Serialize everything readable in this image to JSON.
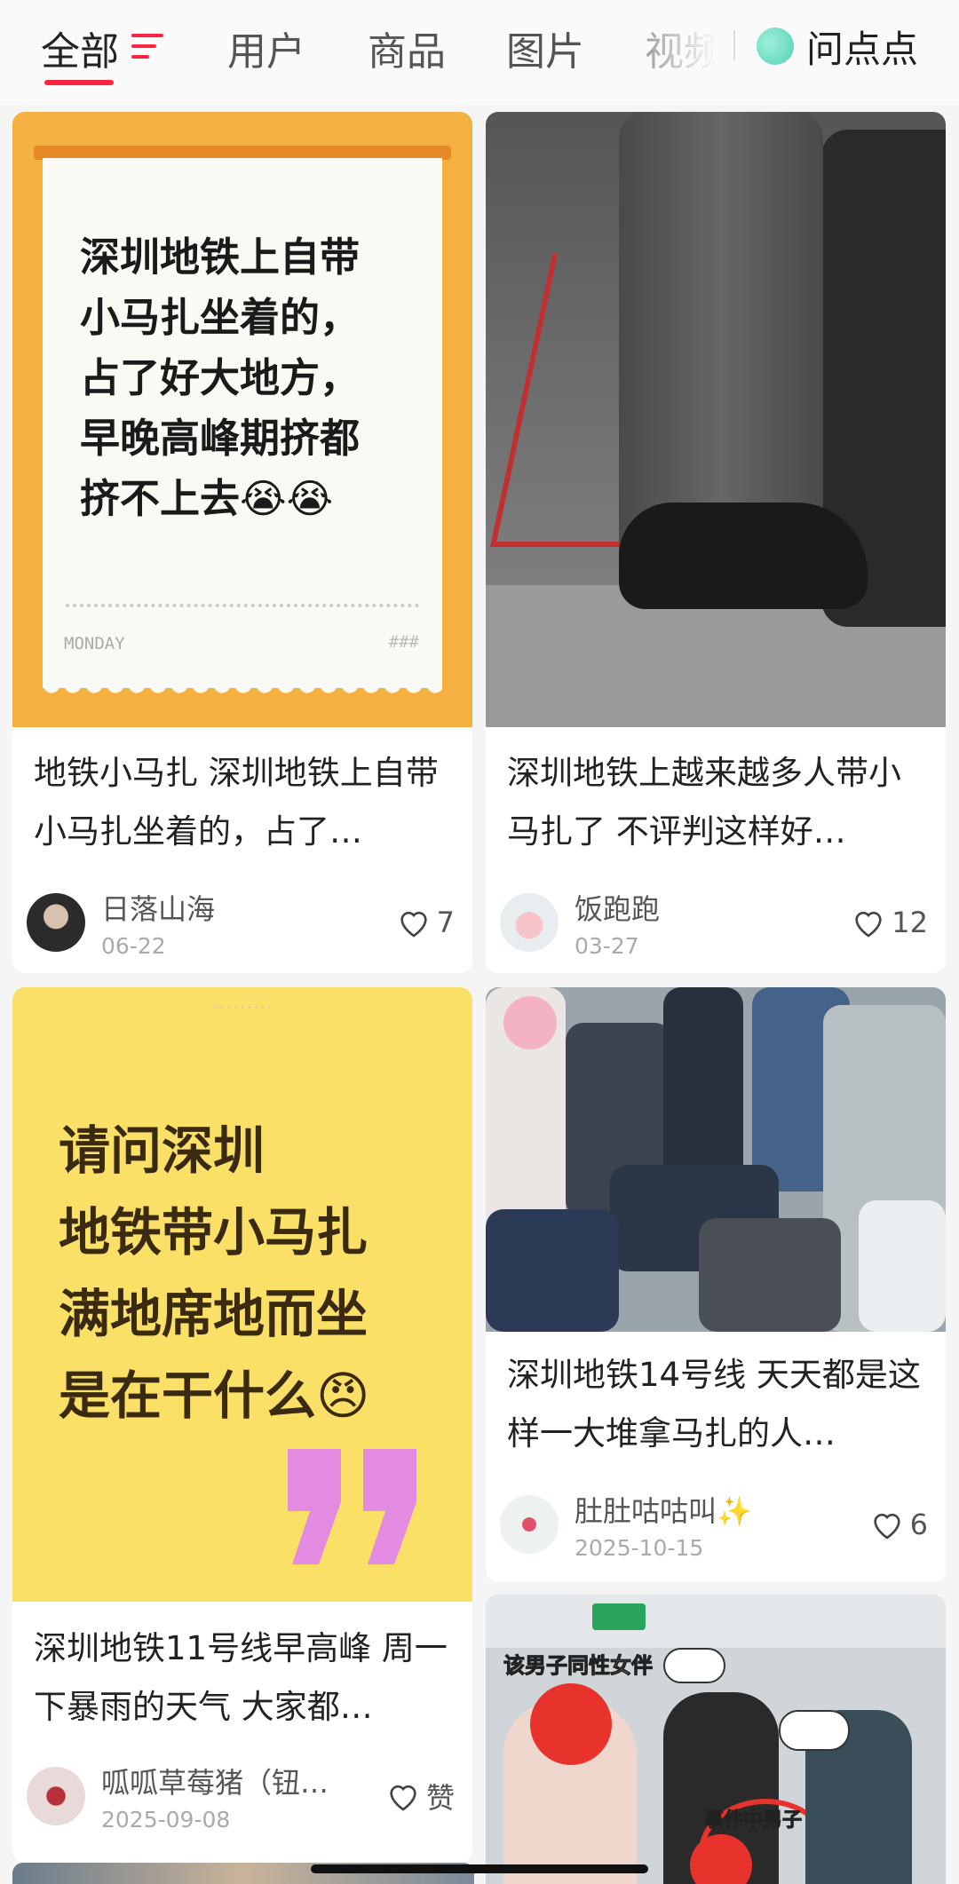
{
  "tabs": [
    {
      "label": "全部",
      "active": true
    },
    {
      "label": "用户"
    },
    {
      "label": "商品"
    },
    {
      "label": "图片"
    },
    {
      "label": "视频"
    }
  ],
  "ask_button": {
    "label": "问点点"
  },
  "accent_color": "#ff2442",
  "cards": [
    {
      "title": "地铁小马扎 深圳地铁上自带小马扎坐着的，占了…",
      "cover_text": "深圳地铁上自带\n小马扎坐着的，\n占了好大地方，\n早晚高峰期挤都\n挤不上去😭😭",
      "cover_footer_left": "MONDAY",
      "cover_footer_right": "###",
      "author": "日落山海",
      "date": "06-22",
      "likes": "7"
    },
    {
      "title": "深圳地铁上越来越多人带小马扎了 不评判这样好…",
      "author": "饭跑跑",
      "date": "03-27",
      "likes": "12"
    },
    {
      "title": "深圳地铁11号线早高峰 周一下暴雨的天气 大家都…",
      "cover_text": "请问深圳\n地铁带小马扎\n满地席地而坐\n是在干什么😠",
      "author": "呱呱草莓猪（钮…",
      "date": "2025-09-08",
      "likes": "赞"
    },
    {
      "title": "深圳地铁14号线 天天都是这样一大堆拿马扎的人…",
      "author": "肚肚咕咕叫✨",
      "date": "2025-10-15",
      "likes": "6"
    },
    {
      "cover_caption_1": "该男子同性女伴",
      "cover_caption_2": "事件中男子"
    }
  ],
  "icons": [
    "filter-icon",
    "heart-icon",
    "ask-icon"
  ]
}
